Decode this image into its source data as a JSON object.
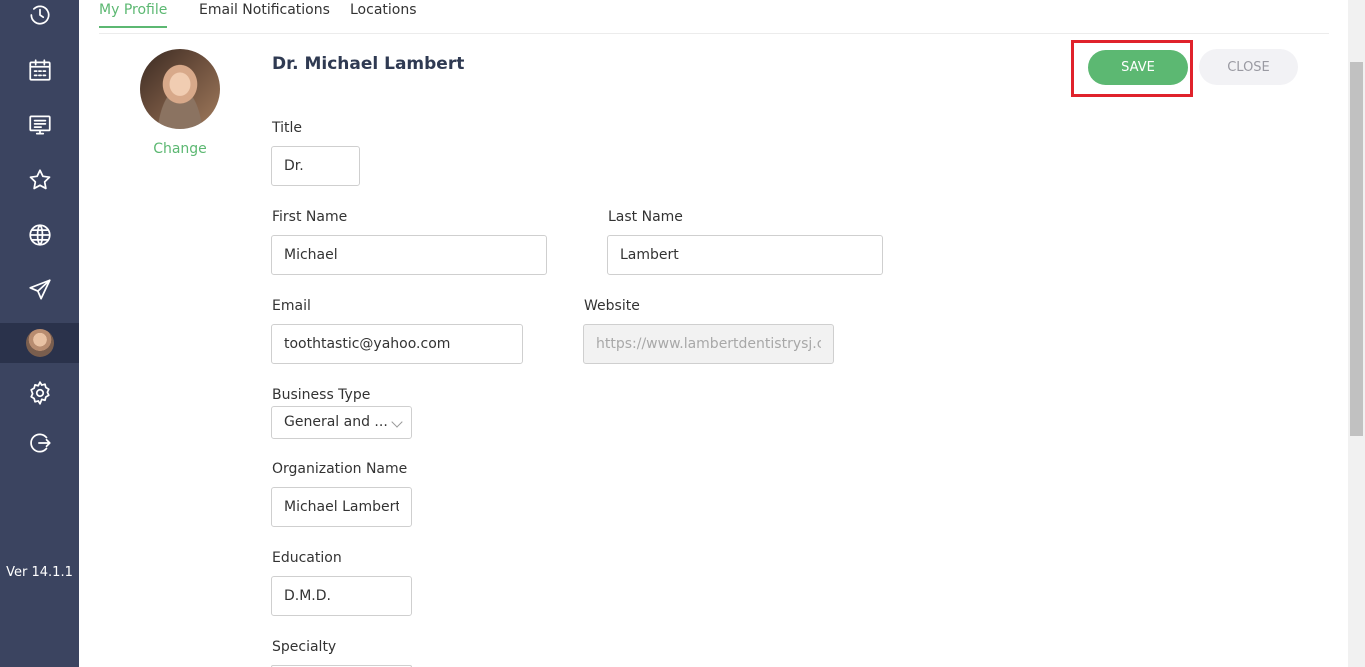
{
  "sidebar": {
    "icons": [
      "history-icon",
      "calendar-icon",
      "presentation-icon",
      "star-icon",
      "globe-icon",
      "send-icon",
      "avatar",
      "gear-icon",
      "logout-icon"
    ],
    "version": "Ver 14.1.1"
  },
  "tabs": {
    "my_profile": "My Profile",
    "email_notifications": "Email Notifications",
    "locations": "Locations"
  },
  "profile": {
    "name": "Dr. Michael Lambert",
    "change_label": "Change"
  },
  "actions": {
    "save": "SAVE",
    "close": "CLOSE"
  },
  "form": {
    "title": {
      "label": "Title",
      "value": "Dr."
    },
    "first_name": {
      "label": "First Name",
      "value": "Michael"
    },
    "last_name": {
      "label": "Last Name",
      "value": "Lambert"
    },
    "email": {
      "label": "Email",
      "value": "toothtastic@yahoo.com"
    },
    "website": {
      "label": "Website",
      "value": "https://www.lambertdentistrysj.com"
    },
    "business_type": {
      "label": "Business Type",
      "value": "General and ..."
    },
    "organization_name": {
      "label": "Organization Name",
      "value": "Michael Lambert, D"
    },
    "education": {
      "label": "Education",
      "value": "D.M.D."
    },
    "specialty": {
      "label": "Specialty"
    }
  },
  "colors": {
    "accent": "#5cb872",
    "sidebar": "#3b4460",
    "highlight": "#e0222b"
  }
}
